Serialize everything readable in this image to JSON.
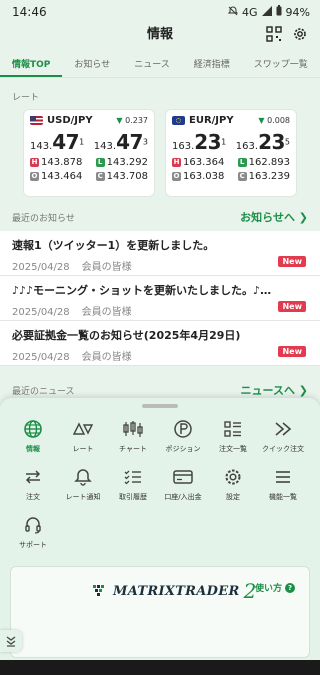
{
  "status": {
    "time": "14:46",
    "network": "4G",
    "battery": "94%"
  },
  "header": {
    "title": "情報"
  },
  "tabs": [
    "情報TOP",
    "お知らせ",
    "ニュース",
    "経済指標",
    "スワップ一覧"
  ],
  "rates_label": "レート",
  "rates": [
    {
      "pair": "USD/JPY",
      "change": "0.237",
      "bid_prefix": "143.",
      "bid_big": "47",
      "bid_sup": "1",
      "ask_prefix": "143.",
      "ask_big": "47",
      "ask_sup": "3",
      "high": "143.878",
      "low": "143.292",
      "open": "143.464",
      "close": "143.708"
    },
    {
      "pair": "EUR/JPY",
      "change": "0.008",
      "bid_prefix": "163.",
      "bid_big": "23",
      "bid_sup": "1",
      "ask_prefix": "163.",
      "ask_big": "23",
      "ask_sup": "5",
      "high": "163.364",
      "low": "162.893",
      "open": "163.038",
      "close": "163.239"
    }
  ],
  "notices": {
    "label": "最近のお知らせ",
    "more": "お知らせへ ❯",
    "items": [
      {
        "title": "速報1（ツイッター1）を更新しました。",
        "date": "2025/04/28",
        "target": "会員の皆様",
        "badge": "New"
      },
      {
        "title": "♪♪♪モーニング・ショットを更新いたしました。♪…",
        "date": "2025/04/28",
        "target": "会員の皆様",
        "badge": "New"
      },
      {
        "title": "必要証拠金一覧のお知らせ(2025年4月29日)",
        "date": "2025/04/28",
        "target": "会員の皆様",
        "badge": "New"
      }
    ]
  },
  "news": {
    "label": "最近のニュース",
    "more": "ニュースへ ❯"
  },
  "menu": [
    {
      "label": "情報",
      "icon": "globe-icon",
      "active": true
    },
    {
      "label": "レート",
      "icon": "rate-triangles-icon"
    },
    {
      "label": "チャート",
      "icon": "candlestick-icon"
    },
    {
      "label": "ポジション",
      "icon": "position-p-icon"
    },
    {
      "label": "注文一覧",
      "icon": "order-list-icon"
    },
    {
      "label": "クイック注文",
      "icon": "quick-order-icon"
    },
    {
      "label": "注文",
      "icon": "order-arrows-icon"
    },
    {
      "label": "レート通知",
      "icon": "bell-icon"
    },
    {
      "label": "取引履歴",
      "icon": "history-checklist-icon"
    },
    {
      "label": "口座/入出金",
      "icon": "card-icon"
    },
    {
      "label": "設定",
      "icon": "gear-icon"
    },
    {
      "label": "機能一覧",
      "icon": "hamburger-icon"
    },
    {
      "label": "サポート",
      "icon": "headset-icon"
    }
  ],
  "banner": {
    "logo": "MATRIXTRADER",
    "logo_num": "2",
    "howto": "使い方"
  },
  "colors": {
    "accent": "#1c8f47",
    "new_badge": "#e23a4f",
    "high": "#d63b4f",
    "low": "#2c9a4e"
  }
}
